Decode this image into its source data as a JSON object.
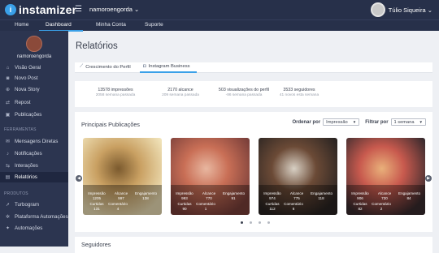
{
  "app": {
    "name": "instamizer",
    "logo_letter": "i"
  },
  "topbar": {
    "menu_icon": "hamburger-icon",
    "account_select": "namoroengorda ⌄",
    "user_name": "Túlio Siqueira ⌄"
  },
  "nav": {
    "items": [
      {
        "label": "Home"
      },
      {
        "label": "Dashboard"
      },
      {
        "label": "Minha Conta"
      },
      {
        "label": "Suporte"
      }
    ],
    "active": "Dashboard"
  },
  "sidebar": {
    "profile_name": "namoroengorda",
    "groups": [
      {
        "items": [
          {
            "label": "Visão Geral",
            "icon": "home-icon"
          },
          {
            "label": "Novo Post",
            "icon": "camera-icon"
          },
          {
            "label": "Nova Story",
            "icon": "plus-circle-icon"
          },
          {
            "label": "Repost",
            "icon": "repost-icon"
          },
          {
            "label": "Publicações",
            "icon": "images-icon"
          }
        ]
      },
      {
        "title": "FERRAMENTAS",
        "items": [
          {
            "label": "Mensagens Diretas",
            "icon": "chat-icon"
          },
          {
            "label": "Notificações",
            "icon": "bell-icon"
          },
          {
            "label": "Interações",
            "icon": "interactions-icon"
          },
          {
            "label": "Relatórios",
            "icon": "chart-icon",
            "active": true
          }
        ]
      },
      {
        "title": "PRODUTOS",
        "items": [
          {
            "label": "Turbogram",
            "icon": "rocket-icon"
          },
          {
            "label": "Plataforma Automações",
            "icon": "cog-icon"
          },
          {
            "label": "Automações",
            "icon": "automation-icon"
          }
        ]
      }
    ]
  },
  "main": {
    "title": "Relatórios",
    "tabs": [
      {
        "label": "Crescimento do Perfil",
        "icon": "line-chart-icon"
      },
      {
        "label": "Instagram Business",
        "icon": "instagram-icon",
        "active": true
      }
    ],
    "stats": [
      {
        "main": "13578 impressões",
        "sub": "2058 semana passada"
      },
      {
        "main": "2170 alcance",
        "sub": "209 semana passada"
      },
      {
        "main": "503 visualizações do perfil",
        "sub": "-86 semana passada"
      },
      {
        "main": "3533 seguidores",
        "sub": "41 novos esta semana"
      }
    ],
    "publications": {
      "title": "Principais Publicações",
      "order_label": "Ordenar por",
      "order_value": "Impressão",
      "filter_label": "Filtrar por",
      "filter_value": "1 semana",
      "metric_labels": [
        "Impressão",
        "Alcance",
        "Engajamento",
        "Curtidas",
        "Comentário"
      ],
      "posts": [
        {
          "impressao": "1205",
          "alcance": "997",
          "engajamento": "138",
          "curtidas": "131",
          "comentario": "4",
          "colors": [
            "#f0e2b8",
            "#c9a062",
            "#7b5a2e"
          ]
        },
        {
          "impressao": "993",
          "alcance": "770",
          "engajamento": "91",
          "curtidas": "90",
          "comentario": "1",
          "colors": [
            "#7a3f3a",
            "#c96f56",
            "#e8b7a0"
          ]
        },
        {
          "impressao": "974",
          "alcance": "775",
          "engajamento": "118",
          "curtidas": "112",
          "comentario": "6",
          "colors": [
            "#2a2422",
            "#6b4a36",
            "#d8d0c4"
          ]
        },
        {
          "impressao": "906",
          "alcance": "720",
          "engajamento": "84",
          "curtidas": "82",
          "comentario": "2",
          "colors": [
            "#3a2b2e",
            "#c85a4e",
            "#e9b07a"
          ]
        }
      ],
      "pagination": {
        "count": 4,
        "active": 0
      }
    },
    "followers": {
      "title": "Seguidores"
    }
  }
}
